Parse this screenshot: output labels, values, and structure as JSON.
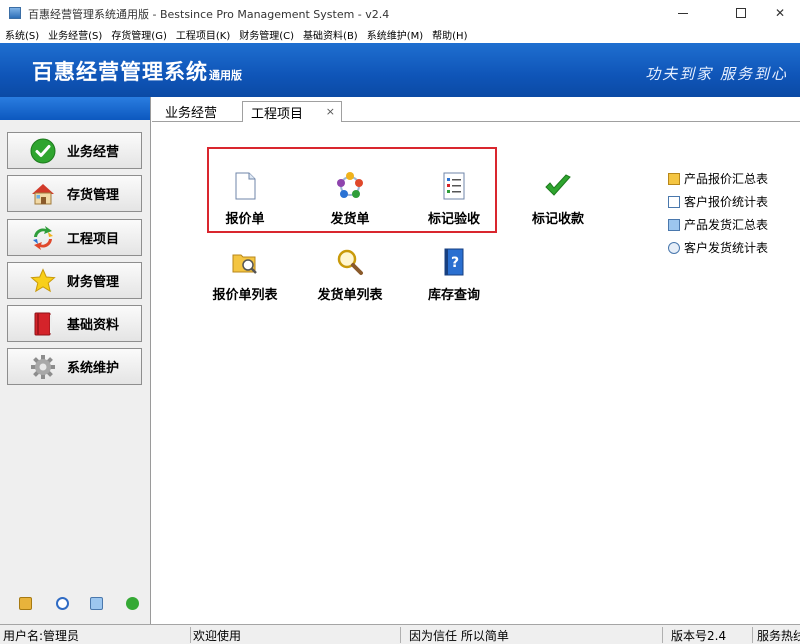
{
  "window": {
    "title": "百惠经营管理系统通用版 - Bestsince Pro Management System - v2.4",
    "close_glyph": "✕"
  },
  "menu": [
    {
      "label": "系统(S)"
    },
    {
      "label": "业务经营(S)"
    },
    {
      "label": "存货管理(G)"
    },
    {
      "label": "工程项目(K)"
    },
    {
      "label": "财务管理(C)"
    },
    {
      "label": "基础资料(B)"
    },
    {
      "label": "系统维护(M)"
    },
    {
      "label": "帮助(H)"
    }
  ],
  "banner": {
    "title": "百惠经营管理系统",
    "edition": "通用版",
    "slogan": "功夫到家  服务到心",
    "color": "#0f55b8"
  },
  "sidebar": {
    "items": [
      {
        "label": "业务经营",
        "icon": "check-circle-icon"
      },
      {
        "label": "存货管理",
        "icon": "house-icon"
      },
      {
        "label": "工程项目",
        "icon": "recycle-arrows-icon"
      },
      {
        "label": "财务管理",
        "icon": "star-icon"
      },
      {
        "label": "基础资料",
        "icon": "red-book-icon"
      },
      {
        "label": "系统维护",
        "icon": "gear-icon"
      }
    ],
    "bottom_icons": [
      "folder-icon",
      "clock-icon",
      "monitor-icon",
      "green-arrow-icon"
    ]
  },
  "tabs": [
    {
      "label": "业务经营",
      "active": false
    },
    {
      "label": "工程项目",
      "active": true,
      "close": "×"
    }
  ],
  "functions": [
    {
      "label": "报价单",
      "icon": "document-icon"
    },
    {
      "label": "发货单",
      "icon": "cycle-balls-icon"
    },
    {
      "label": "标记验收",
      "icon": "checklist-icon"
    },
    {
      "label": "标记收款",
      "icon": "green-check-icon"
    },
    {
      "label": "报价单列表",
      "icon": "folder-search-icon"
    },
    {
      "label": "发货单列表",
      "icon": "magnifier-icon"
    },
    {
      "label": "库存查询",
      "icon": "help-book-icon"
    }
  ],
  "reports": [
    {
      "label": "产品报价汇总表",
      "icon": "folder-icon"
    },
    {
      "label": "客户报价统计表",
      "icon": "search-doc-icon"
    },
    {
      "label": "产品发货汇总表",
      "icon": "screen-icon"
    },
    {
      "label": "客户发货统计表",
      "icon": "find-icon"
    }
  ],
  "status": {
    "user": "用户名:管理员",
    "welcome": "欢迎使用",
    "motto": "因为信任 所以简单",
    "version": "版本号2.4",
    "service": "服务热线"
  },
  "colors": {
    "highlight": "#d9262e",
    "accent": "#1f6fd0"
  }
}
